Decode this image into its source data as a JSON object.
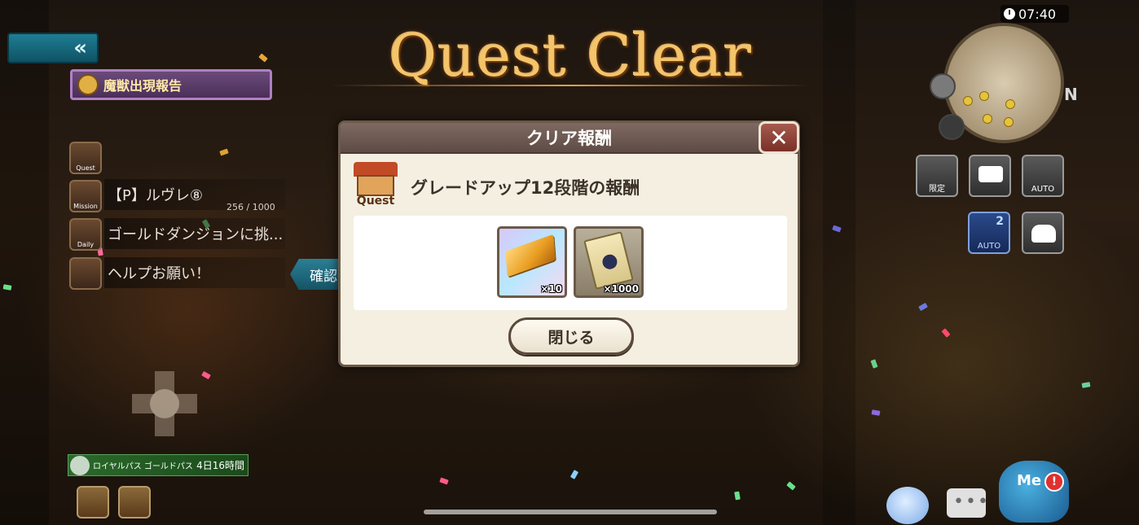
{
  "title": "Quest Clear",
  "clock": "07:40",
  "compass_n": "N",
  "back_button": {
    "glyph": "«"
  },
  "monster_report": {
    "label": "魔獣出現報告",
    "icon": "monster-head-icon"
  },
  "quest_list": [
    {
      "icon_label": "Quest",
      "text": "",
      "icon": "quest-shop-icon"
    },
    {
      "icon_label": "Mission",
      "text": "【P】ルヴレ⑧",
      "progress": "256 / 1000",
      "icon": "mission-icon"
    },
    {
      "icon_label": "Daily",
      "text": "ゴールドダンジョンに挑...",
      "icon": "daily-icon"
    },
    {
      "icon_label": "",
      "text": "ヘルプお願い！",
      "icon": "handshake-icon"
    }
  ],
  "confirm_tab": "確認",
  "dialog": {
    "header": "クリア報酬",
    "close_glyph": "✕",
    "quest_icon_label": "Quest",
    "reward_title": "グレードアップ12段階の報酬",
    "items": [
      {
        "name": "gold-bar",
        "quantity": "×10"
      },
      {
        "name": "ticket",
        "quantity": "×1000"
      }
    ],
    "close_button": "閉じる"
  },
  "hud": {
    "limited": "限定",
    "auto": "AUTO",
    "auto2": "AUTO",
    "auto2_num": "2"
  },
  "royal_pass": {
    "label": "ロイヤルパス ゴールドパス",
    "time": "4日16時間"
  },
  "me_label": "Me",
  "alert": "!",
  "chat_dots": "•••",
  "colors": {
    "title_gold": "#f4c46a",
    "dialog_bg": "#f4efe1",
    "header_bg": "#6e5a53",
    "close_red": "#a65b4f",
    "teal": "#1f7d93"
  }
}
